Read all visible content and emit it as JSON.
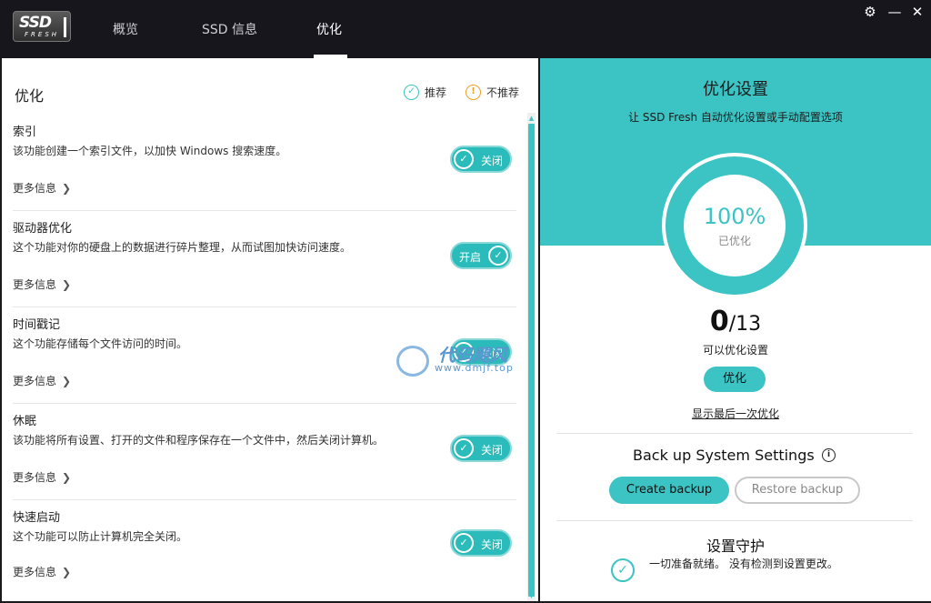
{
  "app": {
    "logo_text": "SSD",
    "logo_sub": "FRESH"
  },
  "nav": {
    "tabs": [
      {
        "label": "概览"
      },
      {
        "label": "SSD 信息"
      },
      {
        "label": "优化",
        "active": true
      }
    ]
  },
  "window": {
    "settings_icon": "gear-icon",
    "minimize": "—",
    "close": "✕"
  },
  "left": {
    "title": "优化",
    "legend": {
      "recommended": "推荐",
      "not_recommended": "不推荐"
    },
    "items": [
      {
        "name": "索引",
        "desc": "该功能创建一个索引文件，以加快 Windows 搜索速度。",
        "more": "更多信息",
        "toggle": "关闭",
        "state": "off"
      },
      {
        "name": "驱动器优化",
        "desc": "这个功能对你的硬盘上的数据进行碎片整理，从而试图加快访问速度。",
        "more": "更多信息",
        "toggle": "开启",
        "state": "on"
      },
      {
        "name": "时间戳记",
        "desc": "这个功能存储每个文件访问的时间。",
        "more": "更多信息",
        "toggle": "关闭",
        "state": "off"
      },
      {
        "name": "休眠",
        "desc": "该功能将所有设置、打开的文件和程序保存在一个文件中，然后关闭计算机。",
        "more": "更多信息",
        "toggle": "关闭",
        "state": "off"
      },
      {
        "name": "快速启动",
        "desc": "这个功能可以防止计算机完全关闭。",
        "more": "更多信息",
        "toggle": "关闭",
        "state": "off"
      }
    ]
  },
  "right": {
    "title": "优化设置",
    "subtitle": "让 SSD Fresh 自动优化设置或手动配置选项",
    "percent": "100%",
    "percent_label": "已优化",
    "count_done": "0",
    "count_total": "/13",
    "count_label": "可以优化设置",
    "optimize_button": "优化",
    "last_link": "显示最后一次优化",
    "backup_title": "Back up System Settings",
    "create_backup": "Create backup",
    "restore_backup": "Restore backup",
    "guard_title": "设置守护",
    "guard_text": "一切准备就绪。 没有检测到设置更改。"
  },
  "watermark": {
    "line1": "代码飓风",
    "line2": "www.dmjf.top"
  },
  "colors": {
    "accent": "#3cc3c3",
    "titlebar": "#17161c",
    "warn": "#f0a020"
  }
}
